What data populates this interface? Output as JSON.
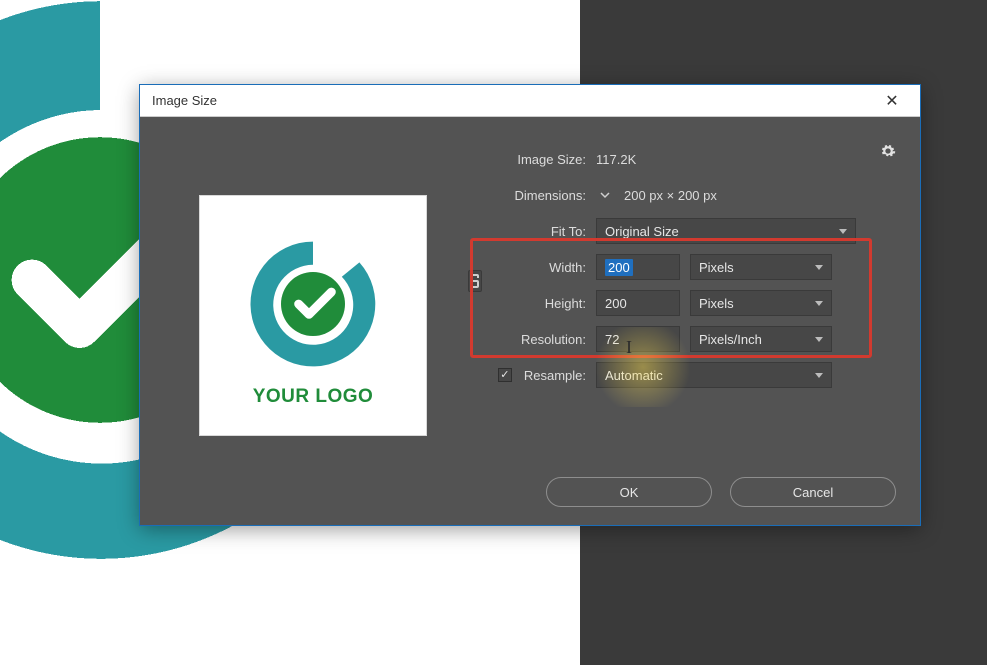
{
  "background": {
    "logo_text": "YOUR LOGO"
  },
  "dialog": {
    "title": "Image Size",
    "close_glyph": "✕",
    "preview": {
      "logo_text": "YOUR LOGO"
    },
    "fields": {
      "image_size_label": "Image Size:",
      "image_size_value": "117.2K",
      "dimensions_label": "Dimensions:",
      "dimensions_value": "200 px  ×  200 px",
      "fit_to_label": "Fit To:",
      "fit_to_value": "Original Size",
      "width_label": "Width:",
      "width_value": "200",
      "width_unit": "Pixels",
      "height_label": "Height:",
      "height_value": "200",
      "height_unit": "Pixels",
      "resolution_label": "Resolution:",
      "resolution_value": "72",
      "resolution_unit": "Pixels/Inch",
      "resample_label": "Resample:",
      "resample_value": "Automatic",
      "resample_checked": true
    },
    "buttons": {
      "ok": "OK",
      "cancel": "Cancel"
    }
  },
  "colors": {
    "dialog_bg": "#535353",
    "accent_teal": "#2a9aa3",
    "accent_green": "#208c3a",
    "highlight_red": "#d23a2f"
  }
}
